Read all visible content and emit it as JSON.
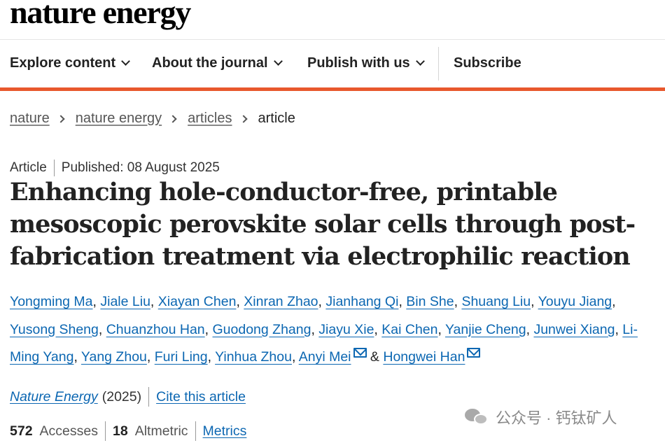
{
  "brand": "nature energy",
  "nav": {
    "items": [
      {
        "label": "Explore content",
        "has_menu": true
      },
      {
        "label": "About the journal",
        "has_menu": true
      },
      {
        "label": "Publish with us",
        "has_menu": true
      },
      {
        "label": "Subscribe",
        "has_menu": false
      }
    ],
    "accent_color": "#e8582d"
  },
  "breadcrumb": [
    "nature",
    "nature energy",
    "articles",
    "article"
  ],
  "article": {
    "type": "Article",
    "published": "Published: 08 August 2025",
    "title": "Enhancing hole-conductor-free, printable mesoscopic perovskite solar cells through post-fabrication treatment via electrophilic reaction",
    "authors": [
      "Yongming Ma",
      "Jiale Liu",
      "Xiayan Chen",
      "Xinran Zhao",
      "Jianhang Qi",
      "Bin She",
      "Shuang Liu",
      "Youyu Jiang",
      "Yusong Sheng",
      "Chuanzhou Han",
      "Guodong Zhang",
      "Jiayu Xie",
      "Kai Chen",
      "Yanjie Cheng",
      "Junwei Xiang",
      "Li-Ming Yang",
      "Yang Zhou",
      "Furi Ling",
      "Yinhua Zhou",
      "Anyi Mei",
      "Hongwei Han"
    ],
    "and_symbol": "&",
    "journal": "Nature Energy",
    "year": "(2025)",
    "cite_label": "Cite this article",
    "accesses_count": "572",
    "accesses_label": "Accesses",
    "altmetric_count": "18",
    "altmetric_label": "Altmetric",
    "metrics_label": "Metrics"
  },
  "watermark": "公众号 · 钙钛矿人",
  "link_color": "#0c67b2"
}
